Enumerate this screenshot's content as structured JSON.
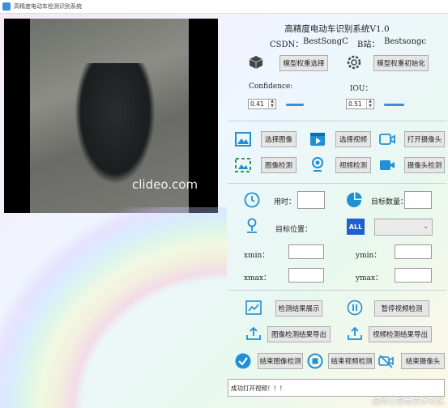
{
  "window": {
    "title": "高精度电动车检测识别系统"
  },
  "preview": {
    "watermark": "clideo.com"
  },
  "header": {
    "title": "高精度电动车识别系统V1.0",
    "csdn_label": "CSDN：",
    "csdn_value": "BestSongC",
    "bili_label": "B站：",
    "bili_value": "Bestsongc"
  },
  "model": {
    "select_label": "模型权重选择",
    "init_label": "模型权重初始化"
  },
  "params": {
    "confidence_label": "Confidence:",
    "confidence_value": "0.41",
    "iou_label": "IOU：",
    "iou_value": "0.51"
  },
  "source": {
    "select_image": "选择图像",
    "select_video": "选择视频",
    "open_camera": "打开摄像头",
    "image_detect": "图像检测",
    "video_detect": "视频检测",
    "camera_detect": "摄像头检测"
  },
  "results": {
    "time_label": "用时：",
    "count_label": "目标数量：",
    "pos_label": "目标位置：",
    "all_icon_text": "ALL",
    "xmin_label": "xmin：",
    "ymin_label": "ymin：",
    "xmax_label": "xmax：",
    "ymax_label": "ymax："
  },
  "actions": {
    "show_results": "检测结果展示",
    "pause_video": "暂停视频检测",
    "export_image": "图像检测结果导出",
    "export_video": "视频检测结果导出",
    "stop_image": "结束图像检测",
    "stop_video": "结束视频检测",
    "stop_camera": "结束摄像头"
  },
  "status": {
    "message": "成功打开视频！！！"
  },
  "footer": {
    "text": "@稀土掘金技术社区"
  }
}
